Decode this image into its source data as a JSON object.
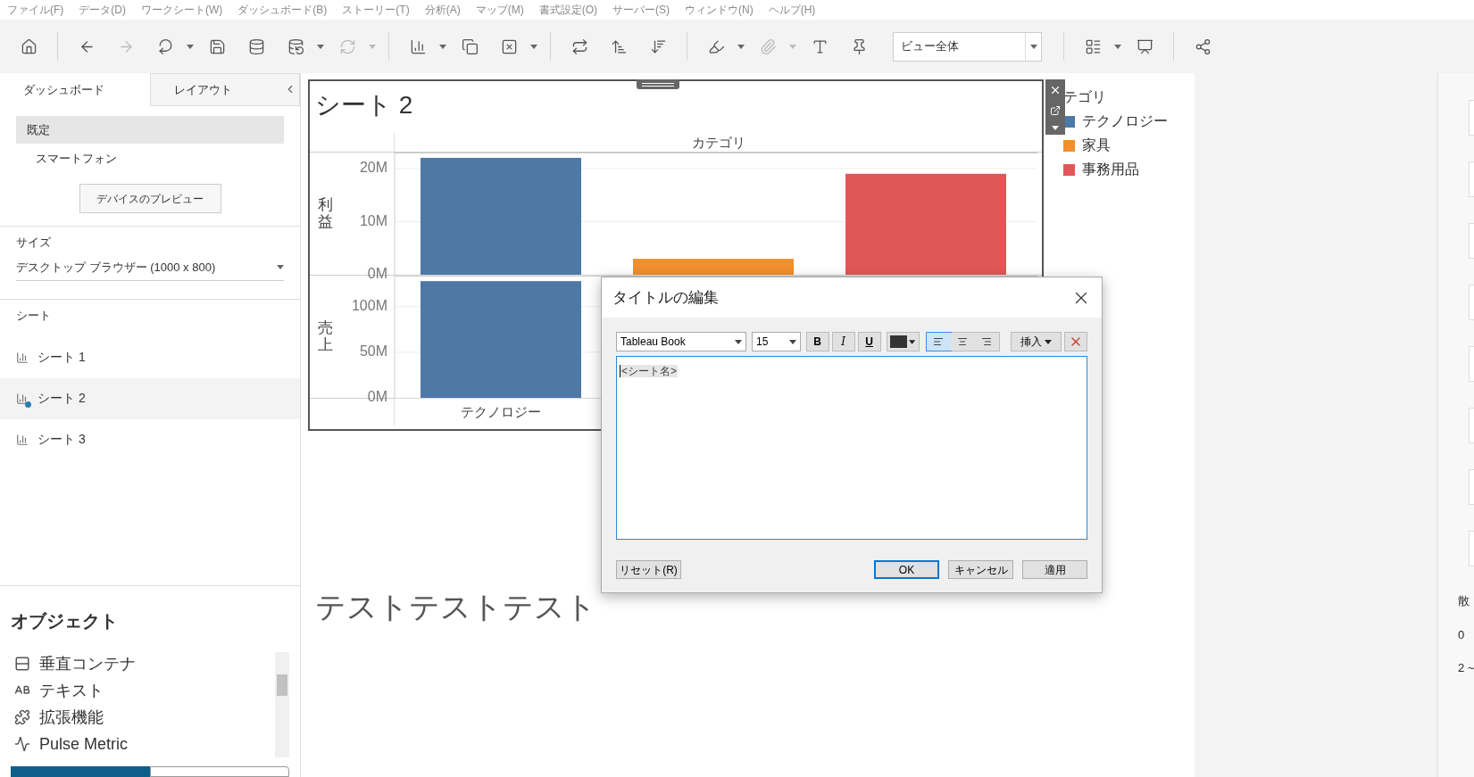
{
  "menu_bar": [
    "ファイル(F)",
    "データ(D)",
    "ワークシート(W)",
    "ダッシュボード(B)",
    "ストーリー(T)",
    "分析(A)",
    "マップ(M)",
    "書式設定(O)",
    "サーバー(S)",
    "ウィンドウ(N)",
    "ヘルプ(H)"
  ],
  "toolbar": [
    {
      "kind": "button",
      "disabled": false,
      "menu": false
    },
    {
      "kind": "separator"
    },
    {
      "kind": "button",
      "disabled": false,
      "menu": false
    },
    {
      "kind": "button",
      "disabled": true,
      "menu": false
    },
    {
      "kind": "button",
      "disabled": false,
      "menu": true
    },
    {
      "kind": "button",
      "disabled": false,
      "menu": false
    },
    {
      "kind": "button",
      "disabled": false,
      "menu": false
    },
    {
      "kind": "button",
      "disabled": false,
      "menu": true
    },
    {
      "kind": "button",
      "disabled": true,
      "menu": true
    },
    {
      "kind": "separator"
    },
    {
      "kind": "button",
      "disabled": false,
      "menu": true
    },
    {
      "kind": "button",
      "disabled": false,
      "menu": false
    },
    {
      "kind": "button",
      "disabled": false,
      "menu": true
    },
    {
      "kind": "separator"
    },
    {
      "kind": "button",
      "disabled": false,
      "menu": false
    },
    {
      "kind": "button",
      "disabled": false,
      "menu": false
    },
    {
      "kind": "button",
      "disabled": false,
      "menu": false
    },
    {
      "kind": "separator"
    },
    {
      "kind": "button",
      "disabled": false,
      "menu": true
    },
    {
      "kind": "button",
      "disabled": true,
      "menu": true
    },
    {
      "kind": "button",
      "disabled": false,
      "menu": false
    },
    {
      "kind": "button",
      "disabled": false,
      "menu": false
    },
    {
      "kind": "dropdown",
      "value": "ビュー全体"
    },
    {
      "kind": "separator"
    },
    {
      "kind": "button",
      "disabled": false,
      "menu": true
    },
    {
      "kind": "button",
      "disabled": false,
      "menu": false
    },
    {
      "kind": "separator"
    },
    {
      "kind": "button",
      "disabled": false,
      "menu": false
    }
  ],
  "side_panel": {
    "tabs": [
      {
        "label": "ダッシュボード",
        "selected": true
      },
      {
        "label": "レイアウト",
        "selected": false
      }
    ],
    "device_options": [
      {
        "label": "既定",
        "selected": true
      },
      {
        "label": "スマートフォン",
        "selected": false
      }
    ],
    "preview_button": "デバイスのプレビュー",
    "size": {
      "label": "サイズ",
      "value": "デスクトップ ブラウザー (1000 x 800)"
    },
    "sheets": {
      "label": "シート",
      "items": [
        {
          "label": "シート 1",
          "selected": false,
          "in_use": false
        },
        {
          "label": "シート 2",
          "selected": true,
          "in_use": true
        },
        {
          "label": "シート 3",
          "selected": false,
          "in_use": false
        }
      ]
    },
    "objects": {
      "title": "オブジェクト",
      "items": [
        "垂直コンテナ",
        "テキスト",
        "拡張機能",
        "Pulse Metric"
      ]
    },
    "layout_mode": [
      {
        "selected": true
      },
      {
        "selected": false
      }
    ]
  },
  "dashboard": {
    "sheet": {
      "title": "シート 2",
      "column_header": "カテゴリ",
      "panes": [
        {
          "chart_data": {
            "type": "bar",
            "series": [
              {
                "name": "利益",
                "values": [
                  22,
                  3,
                  19
                ]
              }
            ],
            "ylim": [
              0,
              23
            ],
            "yticks": [
              {
                "value": 0,
                "label": "0M"
              },
              {
                "value": 10,
                "label": "10M"
              },
              {
                "value": 20,
                "label": "20M"
              }
            ]
          }
        },
        {
          "chart_data": {
            "type": "bar",
            "categories": [
              "テクノロジー",
              null,
              null
            ],
            "series": [
              {
                "name": "売上",
                "values": [
                  128,
                  null,
                  null
                ]
              }
            ],
            "ylim": [
              0,
              134
            ],
            "yticks": [
              {
                "value": 0,
                "label": "0M"
              },
              {
                "value": 50,
                "label": "50M"
              },
              {
                "value": 100,
                "label": "100M"
              }
            ]
          }
        }
      ]
    },
    "legend": {
      "title": "テゴリ",
      "items": [
        {
          "label": "テクノロジー",
          "color": "#4e79a7"
        },
        {
          "label": "家具",
          "color": "#f28e2b"
        },
        {
          "label": "事務用品",
          "color": "#e15759"
        }
      ]
    },
    "text_object": "テストテストテスト"
  },
  "right_panel": {
    "texts": [
      "散",
      "0",
      "2 ~"
    ]
  },
  "dialog": {
    "title": "タイトルの編集",
    "font": "Tableau Book",
    "size": "15",
    "format_buttons": [
      {
        "label": "B",
        "on": false
      },
      {
        "label": "I",
        "on": false
      },
      {
        "label": "U",
        "on": false
      }
    ],
    "alignment": [
      {
        "selected": true
      },
      {
        "selected": false
      },
      {
        "selected": false
      }
    ],
    "insert_button": "挿入",
    "content": "<シート名>",
    "buttons": [
      {
        "label": "リセット(R)",
        "default": false
      },
      {
        "label": "OK",
        "default": true
      },
      {
        "label": "キャンセル",
        "default": false
      },
      {
        "label": "適用",
        "default": false
      }
    ]
  }
}
